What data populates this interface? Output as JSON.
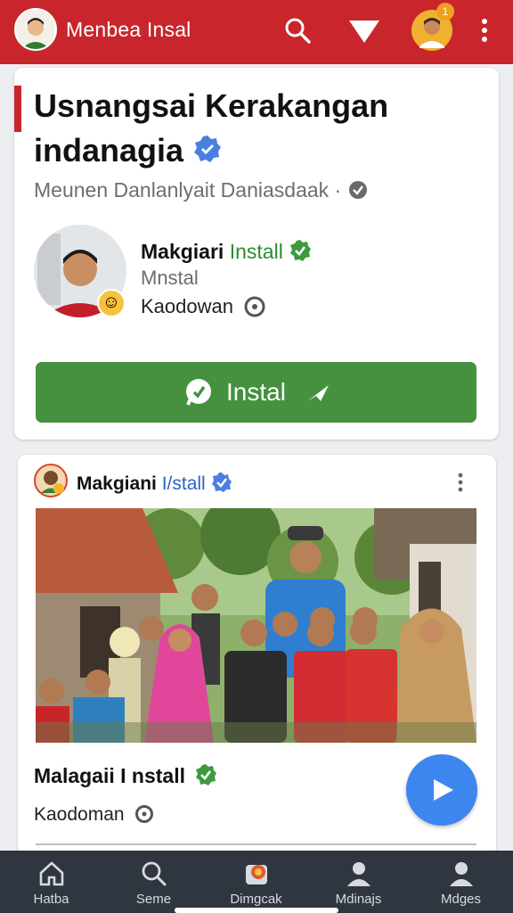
{
  "header": {
    "title": "Menbea Insal",
    "notification_count": "1"
  },
  "card": {
    "headline_line1": "Usnangsai Kerakangan",
    "headline_line2": "indanagia",
    "subline": "Meunen Danlanlyait Daniasdaak ·",
    "profile": {
      "name": "Makgiari",
      "name_highlight": "Install",
      "subtitle": "Mnstal",
      "location": "Kaodowan"
    },
    "install_button_label": "Instal"
  },
  "post": {
    "author": "Makgiani",
    "author_highlight": "I/stall",
    "name": "Malagaii I nstall",
    "location": "Kaodoman"
  },
  "bottom_nav": [
    {
      "label": "Hatba",
      "icon": "home-icon"
    },
    {
      "label": "Seme",
      "icon": "search-icon"
    },
    {
      "label": "Dimgcak",
      "icon": "notifications-icon"
    },
    {
      "label": "Mdinajs",
      "icon": "person-icon"
    },
    {
      "label": "Mdges",
      "icon": "profile-icon"
    }
  ],
  "colors": {
    "brand_red": "#c8262c",
    "install_green": "#45913f",
    "fab_blue": "#3d86f0",
    "nav_bg": "#2f3640"
  }
}
